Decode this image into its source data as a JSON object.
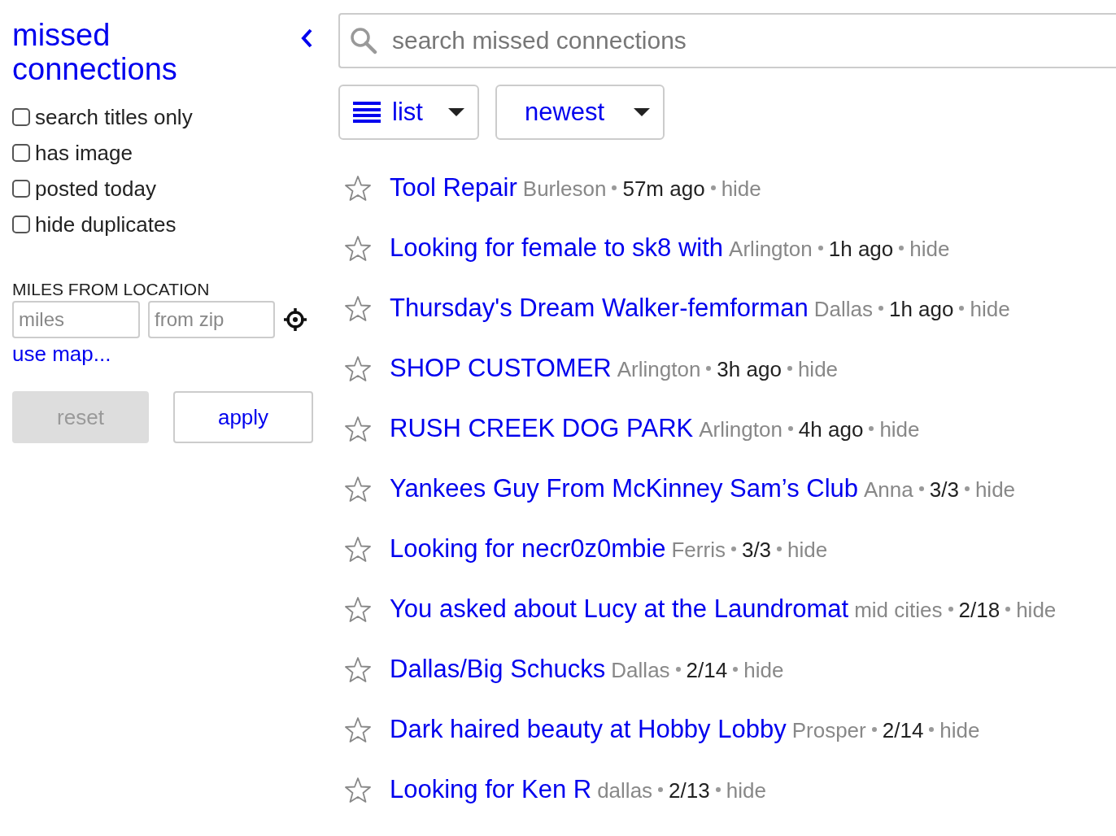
{
  "sidebar": {
    "title": "missed connections",
    "filters": [
      {
        "label": "search titles only",
        "checked": false
      },
      {
        "label": "has image",
        "checked": false
      },
      {
        "label": "posted today",
        "checked": false
      },
      {
        "label": "hide duplicates",
        "checked": false
      }
    ],
    "distance": {
      "heading": "MILES FROM LOCATION",
      "miles": {
        "placeholder": "miles"
      },
      "zip": {
        "placeholder": "from zip"
      },
      "map_link": "use map..."
    },
    "buttons": [
      {
        "label": "reset",
        "disabled": true
      },
      {
        "label": "apply",
        "disabled": false
      }
    ]
  },
  "search": {
    "placeholder": "search missed connections"
  },
  "view_dropdown": {
    "label": "list"
  },
  "sort_dropdown": {
    "label": "newest"
  },
  "posts": [
    {
      "title": "Tool Repair",
      "location": "Burleson",
      "time": "57m ago",
      "hide": "hide",
      "starred": false
    },
    {
      "title": "Looking for female to sk8 with",
      "location": "Arlington",
      "time": "1h ago",
      "hide": "hide",
      "starred": false
    },
    {
      "title": "Thursday's Dream Walker-femforman",
      "location": "Dallas",
      "time": "1h ago",
      "hide": "hide",
      "starred": false
    },
    {
      "title": "SHOP CUSTOMER",
      "location": "Arlington",
      "time": "3h ago",
      "hide": "hide",
      "starred": false
    },
    {
      "title": "RUSH CREEK DOG PARK",
      "location": "Arlington",
      "time": "4h ago",
      "hide": "hide",
      "starred": false
    },
    {
      "title": "Yankees Guy From McKinney Sam’s Club",
      "location": "Anna",
      "time": "3/3",
      "hide": "hide",
      "starred": false
    },
    {
      "title": "Looking for necr0z0mbie",
      "location": "Ferris",
      "time": "3/3",
      "hide": "hide",
      "starred": false
    },
    {
      "title": "You asked about Lucy at the Laundromat",
      "location": "mid cities",
      "time": "2/18",
      "hide": "hide",
      "starred": false
    },
    {
      "title": "Dallas/Big Schucks",
      "location": "Dallas",
      "time": "2/14",
      "hide": "hide",
      "starred": false
    },
    {
      "title": "Dark haired beauty at Hobby Lobby",
      "location": "Prosper",
      "time": "2/14",
      "hide": "hide",
      "starred": false
    },
    {
      "title": "Looking for Ken R",
      "location": "dallas",
      "time": "2/13",
      "hide": "hide",
      "starred": false
    }
  ]
}
